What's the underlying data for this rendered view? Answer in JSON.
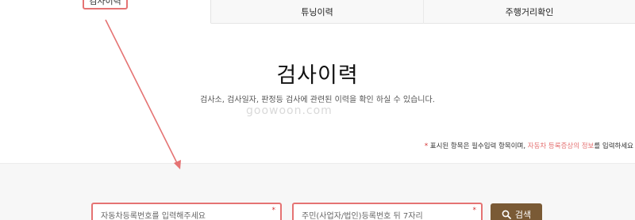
{
  "tabs": [
    {
      "label": "검사이력"
    },
    {
      "label": "튜닝이력"
    },
    {
      "label": "주행거리확인"
    }
  ],
  "main": {
    "title": "검사이력",
    "description": "검사소, 검사일자, 판정등 검사에 관련된 이력을 확인 하실 수 있습니다.",
    "watermark": "goowoon.com"
  },
  "notice": {
    "star": "*",
    "text_1": "표시된 항목은 필수입력 항목이며,",
    "highlight": "자동차 등록증상의 정보",
    "text_2": "를 입력하세요"
  },
  "form": {
    "car_number_placeholder": "자동차등록번호를 입력해주세요",
    "id_number_placeholder": "주민(사업자/법인)등록번호 뒤 7자리",
    "required_mark": "*",
    "search_label": "검색",
    "search_icon": "search-icon"
  },
  "colors": {
    "highlight_border": "#e57373",
    "button_bg": "#7a5a35",
    "required": "#d32f2f"
  }
}
